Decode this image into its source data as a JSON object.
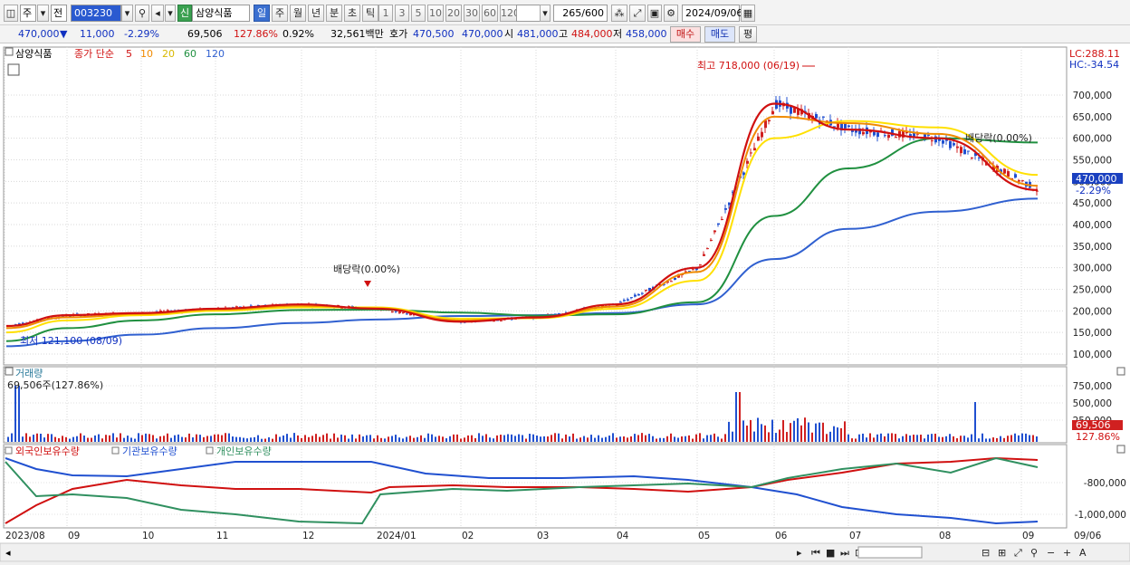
{
  "toolbar": {
    "market": "주",
    "prev_label": "전",
    "code": "003230",
    "badge": "신",
    "stock_name": "삼양식품",
    "periods": [
      "일",
      "주",
      "월",
      "년",
      "분",
      "초",
      "틱"
    ],
    "selected_period": "일",
    "intervals": [
      "1",
      "3",
      "5",
      "10",
      "20",
      "30",
      "60",
      "120"
    ],
    "count": "265",
    "count_total": "/600",
    "date": "2024/09/06"
  },
  "quote": {
    "price": "470,000",
    "change": "11,000",
    "change_pct": "-2.29%",
    "volume": "69,506",
    "volume_ratio": "127.86%",
    "turnover_pct": "0.92%",
    "amount": "32,561백만",
    "bid_label": "호가",
    "ask": "470,500",
    "bid": "470,000",
    "open_label": "시",
    "open": "481,000",
    "high_label": "고",
    "high": "484,000",
    "low_label": "저",
    "low": "458,000",
    "buy_button": "매수",
    "sell_button": "매도",
    "eval_button": "평"
  },
  "price_panel": {
    "name_tag": "삼양식품",
    "ma_title": "종가 단순",
    "ma_periods": [
      "5",
      "10",
      "20",
      "60",
      "120"
    ],
    "ma_colors": [
      "#d01010",
      "#f08a00",
      "#ffe000",
      "#209040",
      "#3060d0"
    ],
    "lc": "LC:288.11",
    "hc": "HC:-34.54",
    "high_annotation": "최고 718,000 (06/19)",
    "low_annotation": "최저 121,100 (08/09)",
    "dividend_annotation_1": "배당락(0.00%)",
    "dividend_annotation_2": "배당락(0.00%)",
    "current_price_tag": "470,000",
    "current_change_tag": "-2.29%",
    "y_ticks": [
      "700,000",
      "650,000",
      "600,000",
      "550,000",
      "500,000",
      "450,000",
      "400,000",
      "350,000",
      "300,000",
      "250,000",
      "200,000",
      "150,000",
      "100,000"
    ]
  },
  "volume_panel": {
    "title": "거래량",
    "readout": "69,506주(127.86%)",
    "y_ticks": [
      "750,000",
      "500,000",
      "250,000"
    ],
    "current_tag": "69,506",
    "current_pct_tag": "127.86%"
  },
  "holding_panel": {
    "series": [
      "외국인보유수량",
      "기관보유수량",
      "개인보유수량"
    ],
    "colors": [
      "#d01010",
      "#2050d0",
      "#309060"
    ],
    "y_ticks": [
      "-800,000",
      "-1,000,000"
    ]
  },
  "x_axis": {
    "labels": [
      "2023/08",
      "09",
      "10",
      "11",
      "12",
      "2024/01",
      "02",
      "03",
      "04",
      "05",
      "06",
      "07",
      "08",
      "09"
    ],
    "right_label": "09/06"
  },
  "chart_data": {
    "type": "line",
    "title": "",
    "xlabel": "",
    "ylabel": "",
    "x": [
      "2023/08",
      "2023/09",
      "2023/10",
      "2023/11",
      "2023/12",
      "2024/01",
      "2024/02",
      "2024/03",
      "2024/04",
      "2024/05",
      "2024/06",
      "2024/07",
      "2024/08",
      "2024/09"
    ],
    "ylim": [
      100000,
      730000
    ],
    "series": [
      {
        "name": "5",
        "values": [
          165000,
          190000,
          195000,
          205000,
          215000,
          205000,
          175000,
          185000,
          215000,
          300000,
          680000,
          620000,
          600000,
          480000
        ]
      },
      {
        "name": "10",
        "values": [
          160000,
          185000,
          193000,
          203000,
          212000,
          206000,
          178000,
          184000,
          210000,
          290000,
          650000,
          635000,
          610000,
          490000
        ]
      },
      {
        "name": "20",
        "values": [
          150000,
          178000,
          190000,
          200000,
          208000,
          208000,
          182000,
          183000,
          205000,
          270000,
          600000,
          640000,
          625000,
          515000
        ]
      },
      {
        "name": "60",
        "values": [
          130000,
          160000,
          178000,
          192000,
          202000,
          203000,
          196000,
          189000,
          192000,
          220000,
          420000,
          530000,
          600000,
          590000
        ]
      },
      {
        "name": "120",
        "values": [
          118000,
          130000,
          145000,
          160000,
          172000,
          180000,
          188000,
          190000,
          195000,
          215000,
          320000,
          390000,
          430000,
          460000
        ]
      }
    ],
    "grid": true,
    "legend": "top-left"
  }
}
